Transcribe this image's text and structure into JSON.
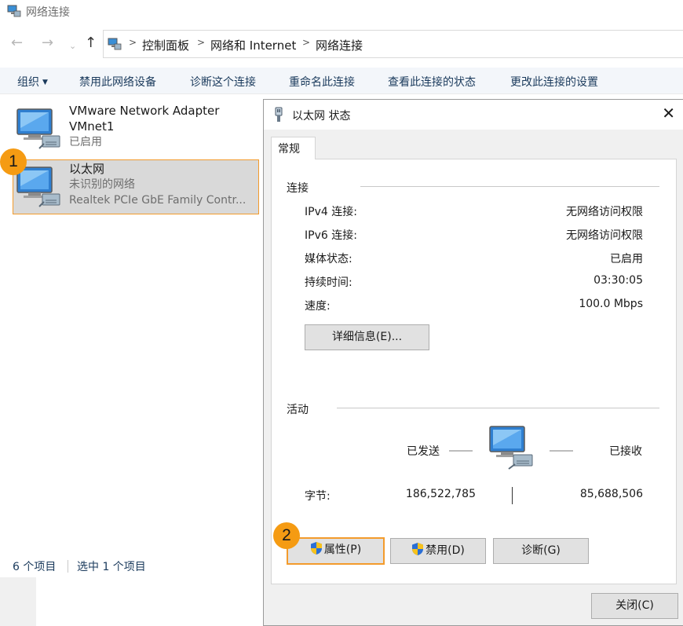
{
  "window": {
    "title": "网络连接",
    "title_icon": "network-connections-icon"
  },
  "nav": {
    "back_icon": "back-arrow-icon",
    "forward_icon": "forward-arrow-icon",
    "recent_icon": "chevron-down-icon",
    "up_icon": "up-arrow-icon"
  },
  "breadcrumb": {
    "items": [
      "控制面板",
      "网络和 Internet",
      "网络连接"
    ],
    "separator": ">"
  },
  "toolbar": {
    "organize": "组织",
    "disable_device": "禁用此网络设备",
    "diagnose": "诊断这个连接",
    "rename": "重命名此连接",
    "view_status": "查看此连接的状态",
    "change_settings": "更改此连接的设置"
  },
  "connections": [
    {
      "name": "VMware Network Adapter",
      "name_line2": "VMnet1",
      "status": "已启用",
      "selected": false
    },
    {
      "name": "以太网",
      "status": "未识别的网络",
      "adapter": "Realtek PCIe GbE Family Contr...",
      "selected": true
    }
  ],
  "statusbar": {
    "items_count": "6 个项目",
    "selected_count": "选中 1 个项目"
  },
  "badges": {
    "one": "1",
    "two": "2"
  },
  "dialog": {
    "title": "以太网 状态",
    "close_icon": "close-icon",
    "tab": "常规",
    "connection_group": "连接",
    "rows": [
      {
        "label": "IPv4 连接:",
        "value": "无网络访问权限"
      },
      {
        "label": "IPv6 连接:",
        "value": "无网络访问权限"
      },
      {
        "label": "媒体状态:",
        "value": "已启用"
      },
      {
        "label": "持续时间:",
        "value": "03:30:05"
      },
      {
        "label": "速度:",
        "value": "100.0 Mbps"
      }
    ],
    "details_button": "详细信息(E)...",
    "activity_group": "活动",
    "sent_label": "已发送",
    "received_label": "已接收",
    "bytes_label": "字节:",
    "bytes_sent": "186,522,785",
    "bytes_received": "85,688,506",
    "properties_button": "属性(P)",
    "disable_button": "禁用(D)",
    "diagnose_button": "诊断(G)",
    "close_button": "关闭(C)"
  },
  "colors": {
    "accent_orange": "#f39b2c",
    "badge_orange": "#f59b13",
    "selection_gray": "#d9d9d9",
    "toolbar_bg": "#f3f6fa",
    "dialog_bg": "#f0f0f0",
    "button_bg": "#e1e1e1"
  }
}
